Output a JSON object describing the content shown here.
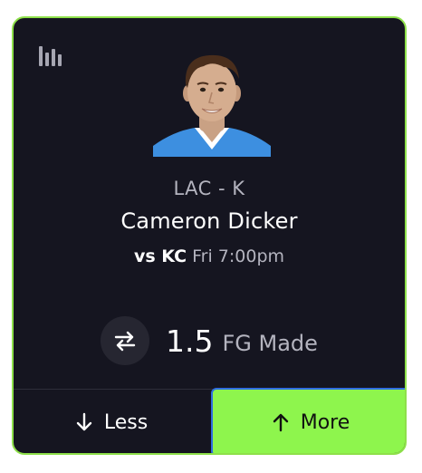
{
  "card": {
    "team_position": "LAC - K",
    "player_name": "Cameron Dicker",
    "matchup": {
      "opponent": "vs KC",
      "time": "Fri 7:00pm"
    },
    "line": {
      "value": "1.5",
      "stat": "FG Made"
    },
    "actions": {
      "less_label": "Less",
      "more_label": "More"
    },
    "icons": {
      "stats": "bar-chart-icon",
      "swap": "swap-arrows-icon",
      "less": "arrow-down-icon",
      "more": "arrow-up-icon"
    },
    "colors": {
      "card_background": "#151520",
      "card_border": "#8ee04a",
      "more_button": "#8ef54d",
      "more_focus_border": "#2f6de0"
    }
  }
}
